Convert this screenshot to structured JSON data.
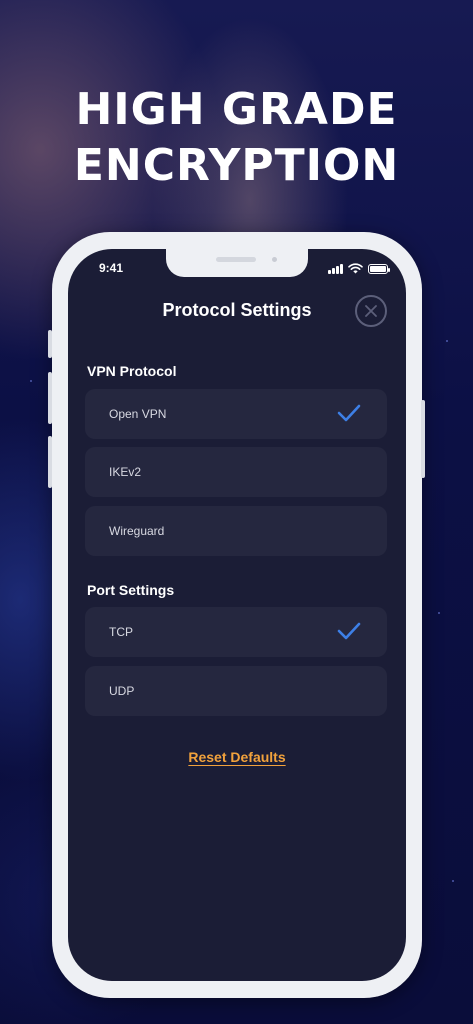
{
  "headline": {
    "line1": "HIGH GRADE",
    "line2": "ENCRYPTION"
  },
  "status_bar": {
    "time": "9:41",
    "icons": [
      "signal-icon",
      "wifi-icon",
      "battery-icon"
    ]
  },
  "screen": {
    "title": "Protocol Settings",
    "close_icon": "close-icon",
    "vpn_protocol": {
      "label": "VPN Protocol",
      "options": [
        {
          "label": "Open VPN",
          "selected": true
        },
        {
          "label": "IKEv2",
          "selected": false
        },
        {
          "label": "Wireguard",
          "selected": false
        }
      ]
    },
    "port_settings": {
      "label": "Port Settings",
      "options": [
        {
          "label": "TCP",
          "selected": true
        },
        {
          "label": "UDP",
          "selected": false
        }
      ]
    },
    "reset_label": "Reset Defaults"
  },
  "colors": {
    "background": "#0b0f3a",
    "screen": "#1b1d36",
    "option_bg": "#25273f",
    "check": "#3d7fe6",
    "reset": "#f2a23c"
  }
}
